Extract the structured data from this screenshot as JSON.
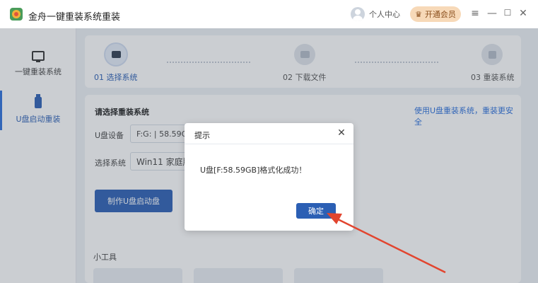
{
  "window": {
    "title": "金舟一键重装系统重装",
    "user_label": "个人中心",
    "vip_label": "开通会员",
    "controls": [
      "≡",
      "—",
      "☐",
      "✕"
    ]
  },
  "sidebar": {
    "items": [
      {
        "label": "一键重装系统",
        "icon": "monitor-icon",
        "active": false
      },
      {
        "label": "U盘启动重装",
        "icon": "usb-drive-icon",
        "active": true
      }
    ]
  },
  "steps": [
    {
      "label": "01 选择系统",
      "icon": "monitor-icon",
      "active": true
    },
    {
      "label": "02 下载文件",
      "icon": "folder-icon",
      "active": false
    },
    {
      "label": "03 重装系统",
      "icon": "grid-icon",
      "active": false
    }
  ],
  "form": {
    "title": "请选择重装系统",
    "link": "使用U盘重装系统，重装更安全",
    "usb_label": "U盘设备",
    "usb_value": "F:G: | 58.59GB |",
    "system_label": "选择系统",
    "system_value": "Win11 家庭版",
    "make_button": "制作U盘启动盘",
    "tools_title": "小工具"
  },
  "dialog": {
    "title": "提示",
    "close": "✕",
    "message": "U盘[F:58.59GB]格式化成功！",
    "ok_button": "确定"
  },
  "colors": {
    "accent": "#2b5fb4",
    "vip": "#f7d9b8",
    "annotation": "#e2452f"
  }
}
